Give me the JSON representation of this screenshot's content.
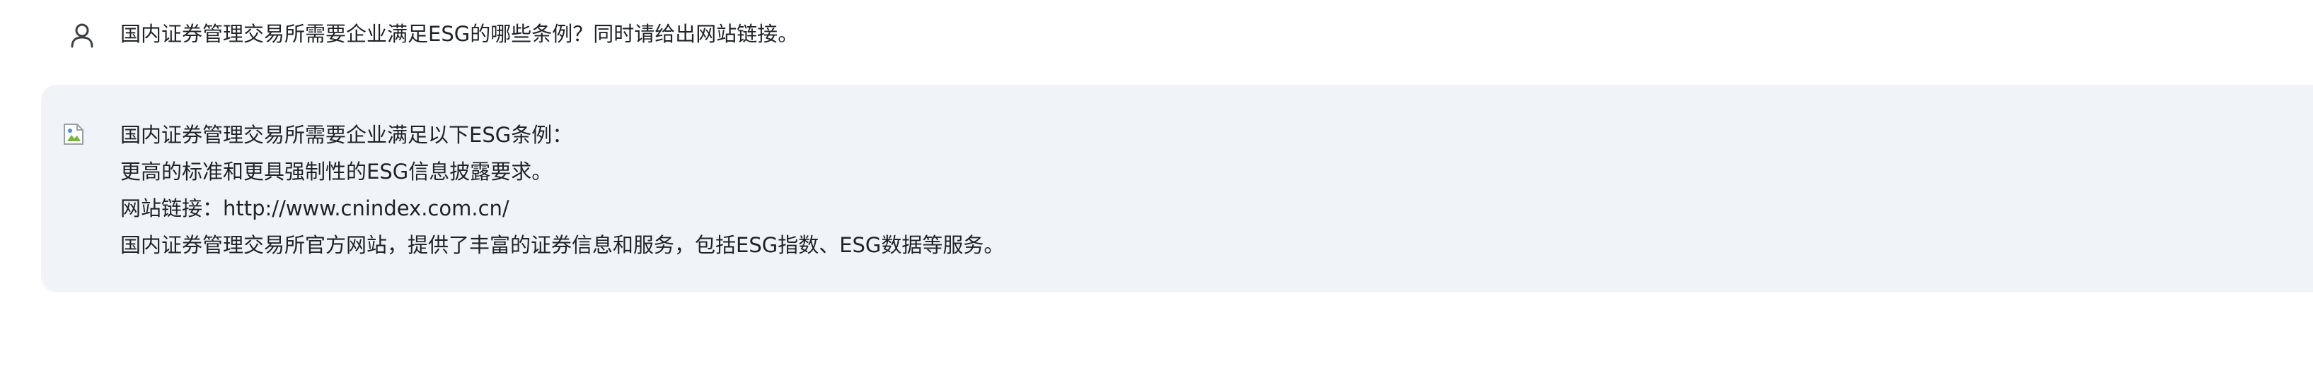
{
  "conversation": {
    "user_message": {
      "icon": "user-icon",
      "text": "国内证券管理交易所需要企业满足ESG的哪些条例？同时请给出网站链接。"
    },
    "assistant_message": {
      "avatar": "broken-image-icon",
      "lines": [
        "国内证券管理交易所需要企业满足以下ESG条例：",
        "更高的标准和更具强制性的ESG信息披露要求。",
        "网站链接：http://www.cnindex.com.cn/",
        "国内证券管理交易所官方网站，提供了丰富的证券信息和服务，包括ESG指数、ESG数据等服务。"
      ]
    }
  },
  "colors": {
    "assistant_bubble_bg": "#f0f4f9",
    "text": "#1f2328",
    "icon": "#3c4043"
  }
}
